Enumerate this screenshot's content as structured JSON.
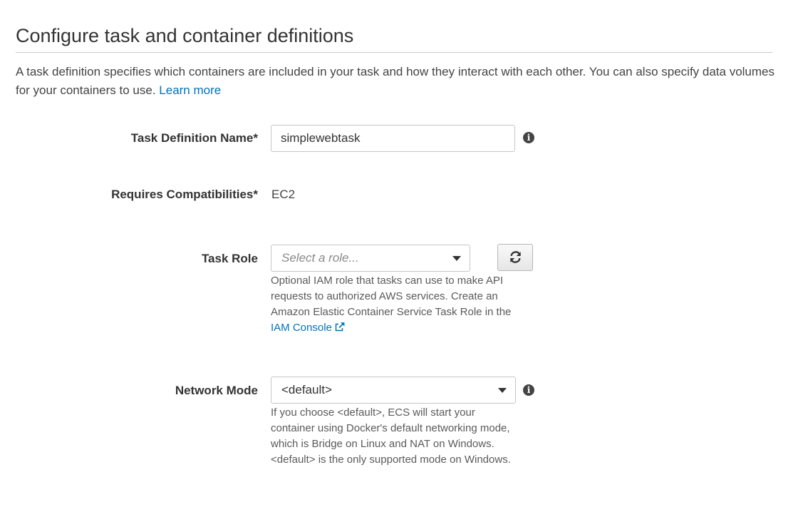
{
  "section": {
    "title": "Configure task and container definitions",
    "description": "A task definition specifies which containers are included in your task and how they interact with each other. You can also specify data volumes for your containers to use.",
    "learn_more_link": "Learn more"
  },
  "fields": {
    "task_definition_name": {
      "label": "Task Definition Name*",
      "value": "simplewebtask",
      "icon": "info-icon"
    },
    "requires_compatibilities": {
      "label": "Requires Compatibilities*",
      "value": "EC2"
    },
    "task_role": {
      "label": "Task Role",
      "placeholder": "Select a role...",
      "refresh_icon": "refresh-icon",
      "help_text": "Optional IAM role that tasks can use to make API requests to authorized AWS services. Create an Amazon Elastic Container Service Task Role in the",
      "help_link": "IAM Console",
      "help_link_icon": "external-link-icon"
    },
    "network_mode": {
      "label": "Network Mode",
      "selected": "<default>",
      "icon": "info-icon",
      "help_text": "If you choose <default>, ECS will start your container using Docker's default networking mode, which is Bridge on Linux and NAT on Windows. <default> is the only supported mode on Windows."
    }
  },
  "colors": {
    "link": "#0073bb",
    "text": "#444444",
    "border": "#c6c6c6"
  }
}
